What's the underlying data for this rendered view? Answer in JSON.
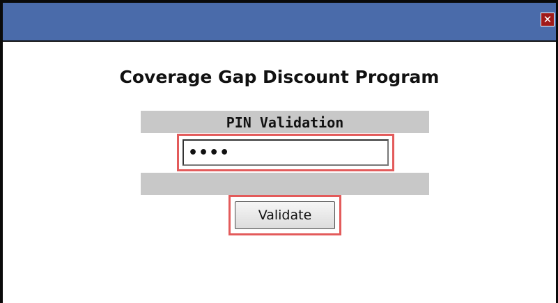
{
  "window": {
    "close_glyph": "✕"
  },
  "dialog": {
    "title": "Coverage Gap Discount Program",
    "section_header": "PIN Validation",
    "pin": {
      "masked_value": "••••"
    },
    "validate_label": "Validate"
  },
  "colors": {
    "titlebar": "#4a6baa",
    "close_button": "#a01a1a",
    "section_bar": "#c8c8c8",
    "highlight": "#e35b5b"
  },
  "icons": {
    "close": "close-icon"
  }
}
